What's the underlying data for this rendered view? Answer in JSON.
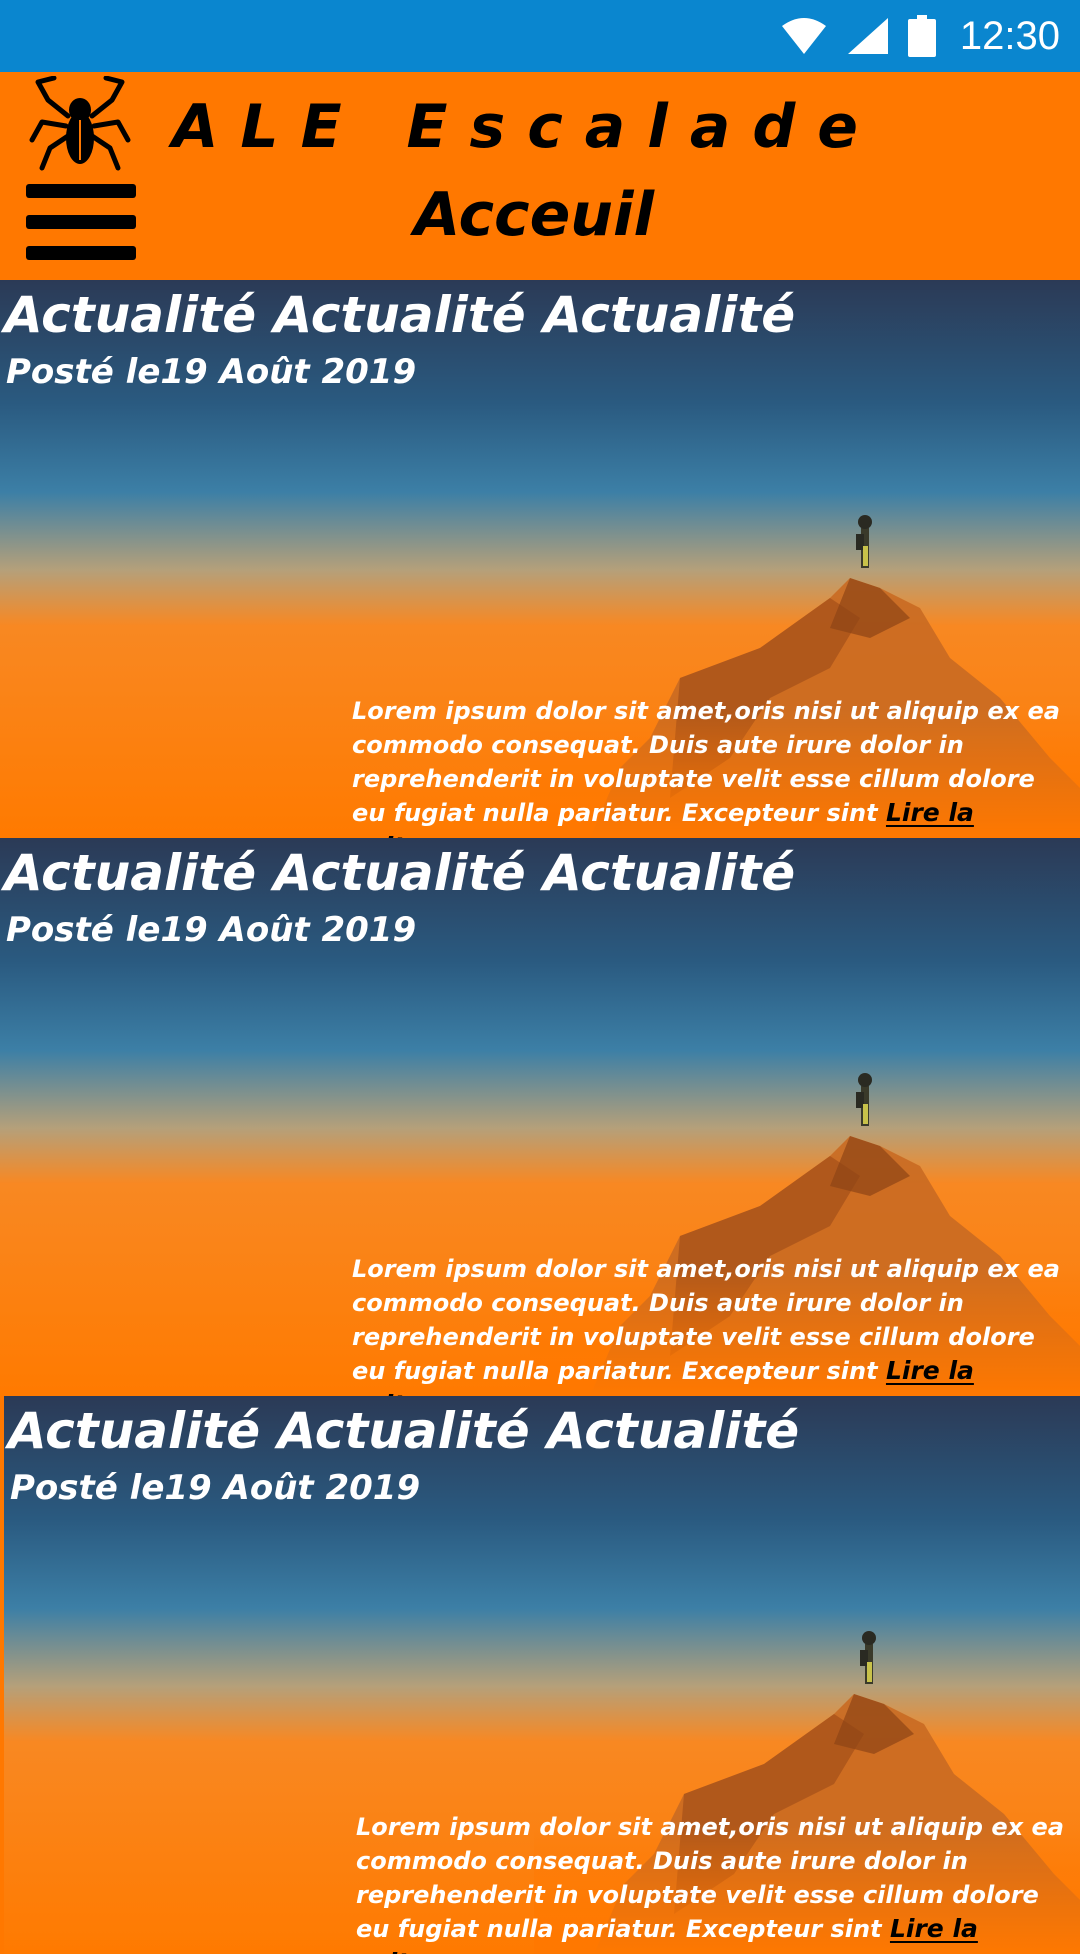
{
  "statusbar": {
    "time": "12:30",
    "icons": [
      "wifi-icon",
      "signal-icon",
      "battery-icon"
    ],
    "color": "#0A86CF"
  },
  "header": {
    "app_title": "ALE Escalade",
    "page_title": "Acceuil",
    "background": "#FF7800"
  },
  "articles": [
    {
      "title": "Actualité Actualité Actualité",
      "date": "Posté le19 Août 2019",
      "excerpt": "Lorem ipsum dolor sit amet,oris nisi ut aliquip ex ea commodo consequat. Duis aute irure dolor in reprehenderit in voluptate velit esse cillum dolore eu fugiat nulla pariatur. Excepteur sint",
      "read_more": "Lire la suite..."
    },
    {
      "title": "Actualité Actualité Actualité",
      "date": "Posté le19 Août 2019",
      "excerpt": "Lorem ipsum dolor sit amet,oris nisi ut aliquip ex ea commodo consequat. Duis aute irure dolor in reprehenderit in voluptate velit esse cillum dolore eu fugiat nulla pariatur. Excepteur sint",
      "read_more": "Lire la suite..."
    },
    {
      "title": "Actualité Actualité Actualité",
      "date": "Posté le19 Août 2019",
      "excerpt": "Lorem ipsum dolor sit amet,oris nisi ut aliquip ex ea commodo consequat. Duis aute irure dolor in reprehenderit in voluptate velit esse cillum dolore eu fugiat nulla pariatur. Excepteur sint",
      "read_more": "Lire la suite..."
    }
  ]
}
